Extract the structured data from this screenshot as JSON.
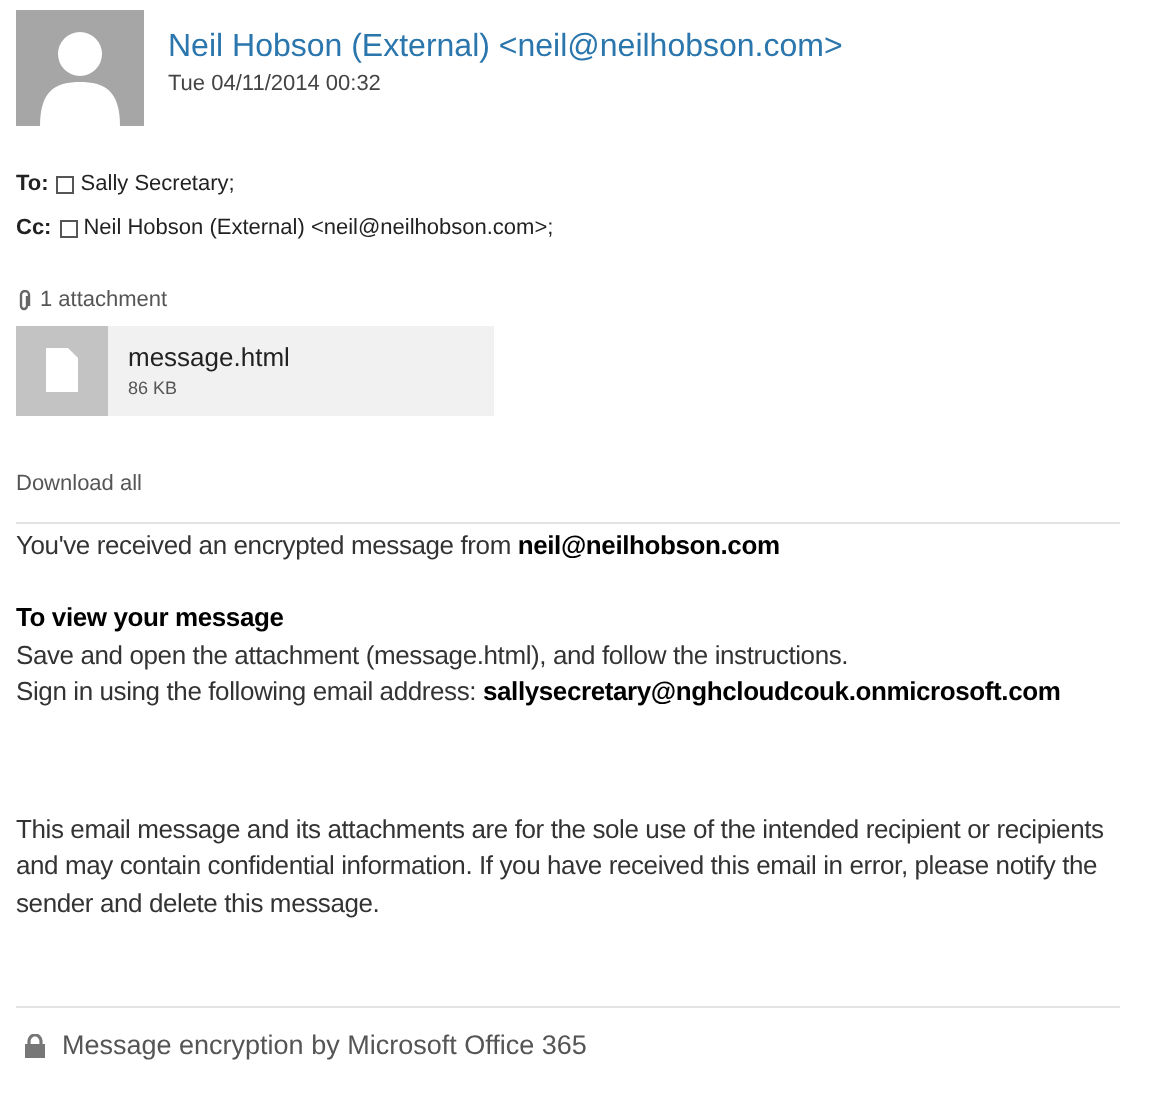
{
  "sender": {
    "name": "Neil Hobson (External) <neil@neilhobson.com>",
    "date": "Tue 04/11/2014 00:32"
  },
  "recipients": [
    {
      "label": "To:",
      "value": "Sally Secretary;"
    },
    {
      "label": "Cc:",
      "value": "Neil Hobson (External) <neil@neilhobson.com>;"
    }
  ],
  "attachments": {
    "count": "1 attachment",
    "files": [
      {
        "name": "message.html",
        "size": "86 KB"
      }
    ],
    "download_all": "Download all"
  },
  "body": {
    "intro": "You've received an encrypted message from **neil@neilhobson.com**",
    "heading": "To view your message",
    "lines": [
      "Save and open the attachment (message.html), and follow the instructions.",
      "Sign in using the following email address: **sallysecretary@nghcloudcouk.onmicrosoft.com**"
    ],
    "disclaimer": "This email message and its attachments are for the sole use of the intended recipient or recipients and may contain confidential information. If you have received this email in error, please notify the sender and delete this message."
  },
  "footer": "Message encryption by Microsoft Office 365"
}
